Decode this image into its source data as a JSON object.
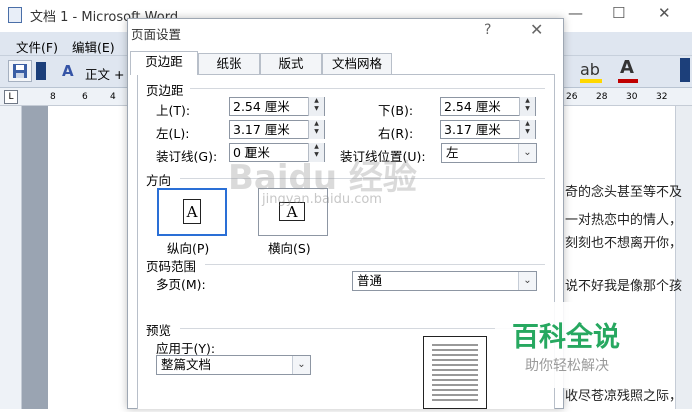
{
  "word": {
    "title": "文档 1 - Microsoft Word",
    "window_buttons": [
      "—",
      "☐",
      "✕"
    ],
    "menu": [
      "文件(F)",
      "编辑(E)"
    ],
    "style_label": "正文 +",
    "ruler_ticks": [
      "8",
      "6",
      "4",
      "26",
      "28",
      "30",
      "32"
    ],
    "doc_lines": [
      "奇的念头甚至等不及",
      "一对热恋中的情人，",
      "刻刻也不想离开你，",
      "说不好我是像那个孩",
      "收尽苍凉残照之际，"
    ],
    "accent_color": "#c00000",
    "highlight_color": "#ffd800"
  },
  "dialog": {
    "title": "页面设置",
    "help": "?",
    "close": "✕",
    "tabs": [
      "页边距",
      "纸张",
      "版式",
      "文档网格"
    ],
    "margins_section": "页边距",
    "top_label": "上(T):",
    "top_value": "2.54 厘米",
    "bottom_label": "下(B):",
    "bottom_value": "2.54 厘米",
    "left_label": "左(L):",
    "left_value": "3.17 厘米",
    "right_label": "右(R):",
    "right_value": "3.17 厘米",
    "gutter_label": "装订线(G):",
    "gutter_value": "0 厘米",
    "gutter_pos_label": "装订线位置(U):",
    "gutter_pos_value": "左",
    "orientation_section": "方向",
    "portrait_label": "纵向(P)",
    "landscape_label": "横向(S)",
    "page_range_section": "页码范围",
    "multiple_pages_label": "多页(M):",
    "multiple_pages_value": "普通",
    "preview_section": "预览",
    "apply_to_label": "应用于(Y):",
    "apply_to_value": "整篇文档",
    "selected_orientation": "portrait",
    "select_color": "#2a6fd6"
  },
  "watermark": {
    "baidu": "Baidu 经验",
    "url": "jingyan.baidu.com",
    "big": "百科全说",
    "small": "助你轻松解决",
    "green": "#27a860"
  }
}
